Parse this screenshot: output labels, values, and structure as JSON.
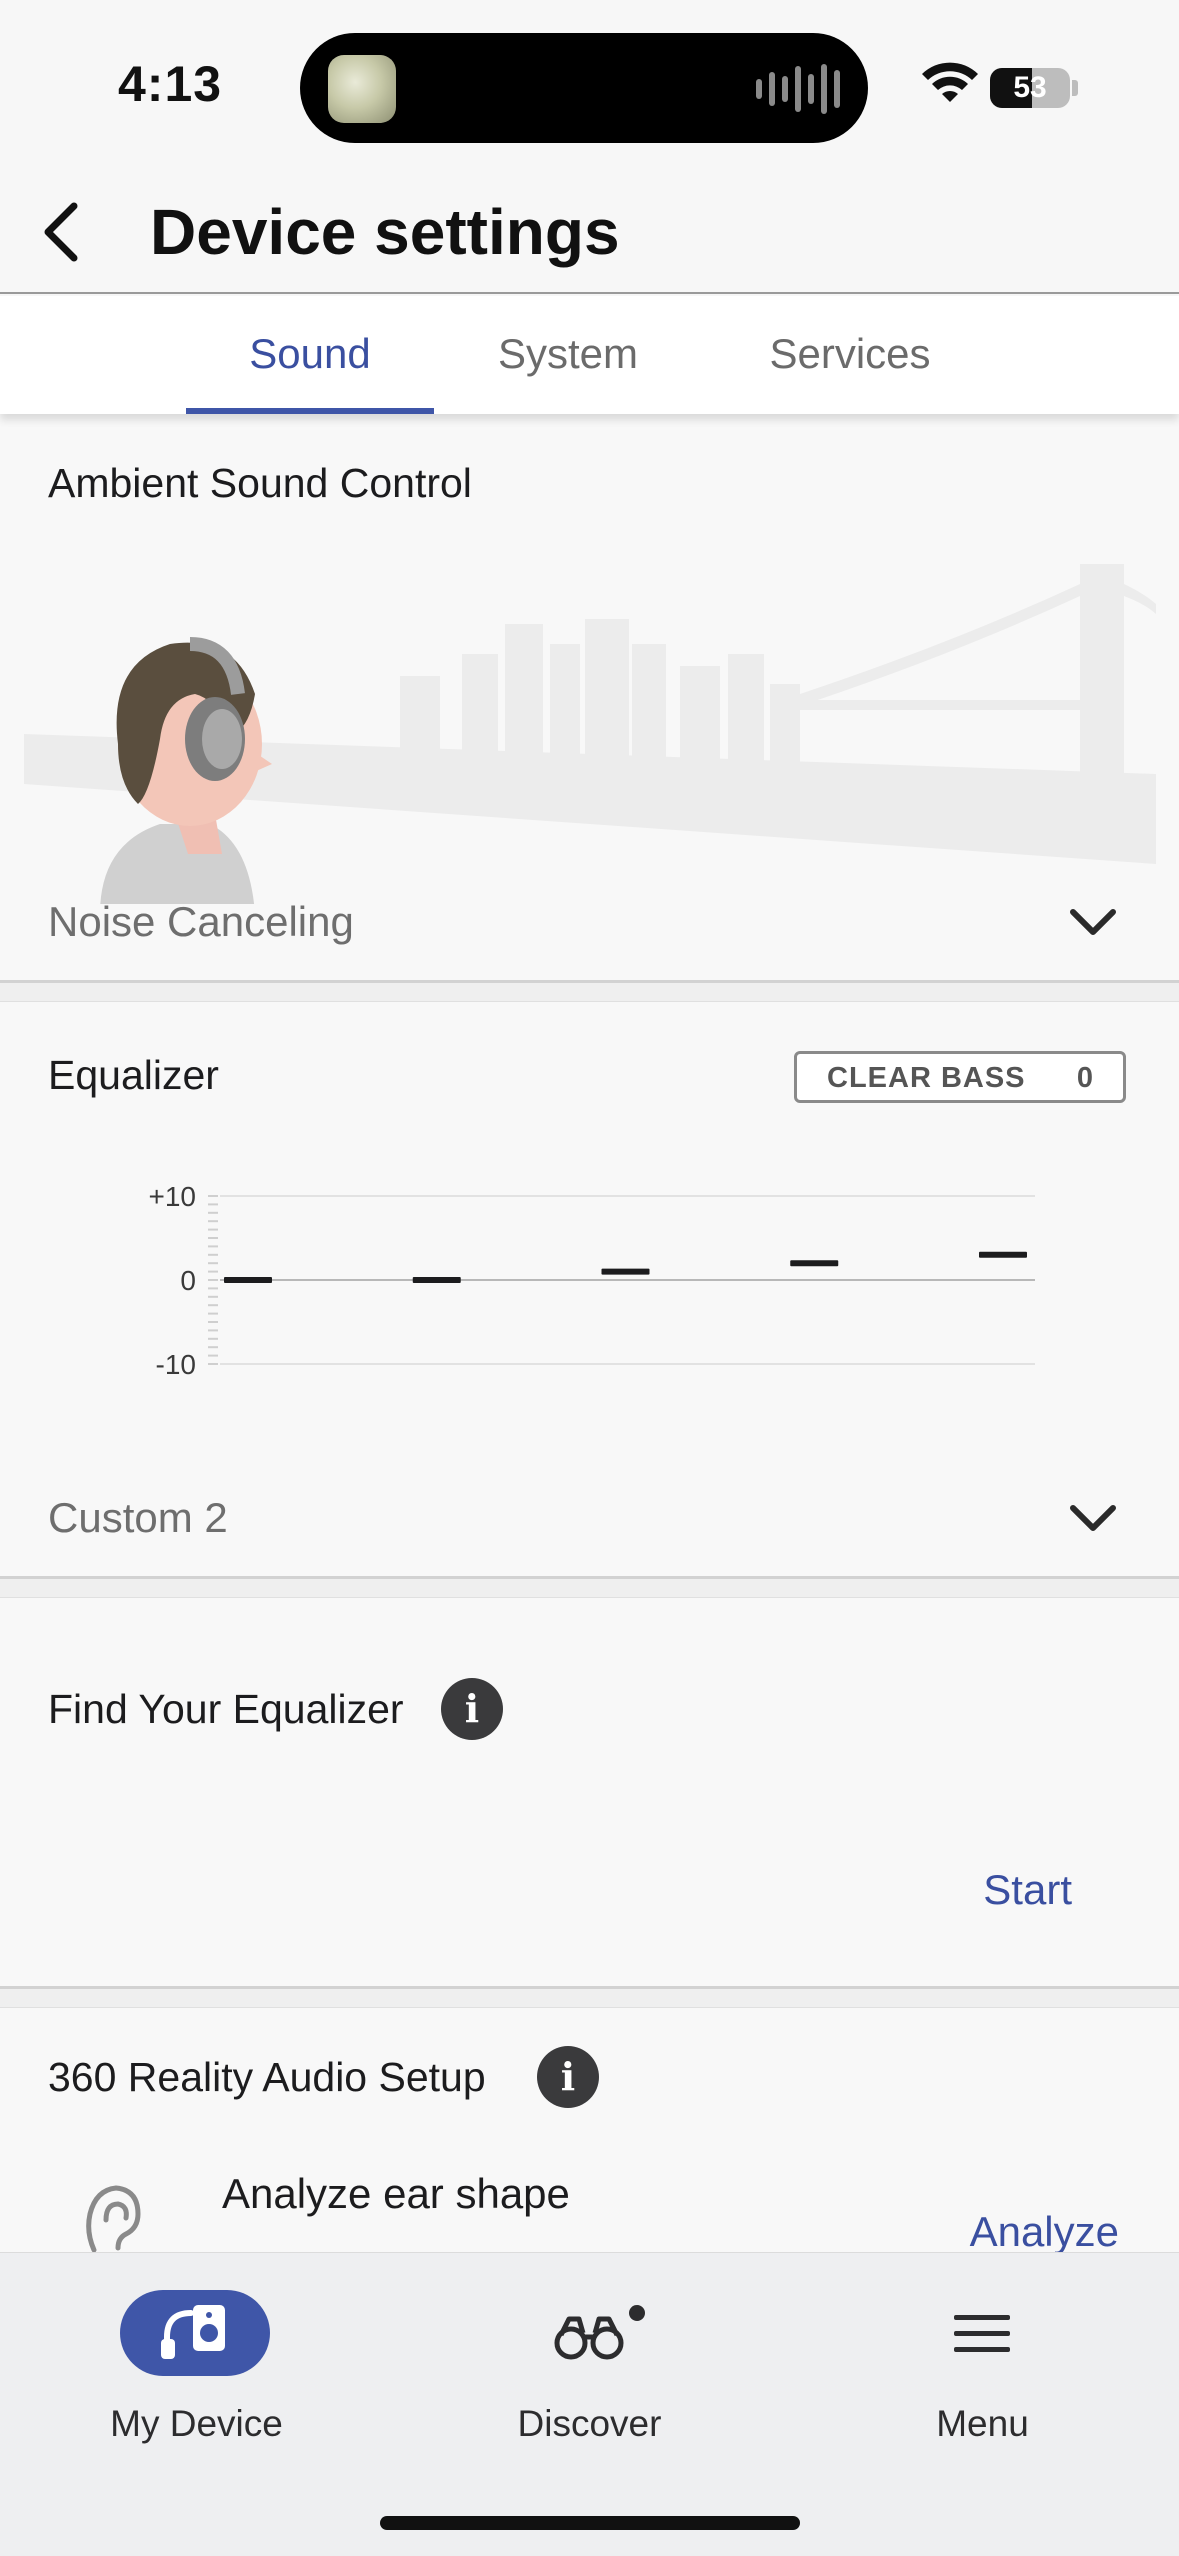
{
  "status_bar": {
    "time": "4:13",
    "battery": "53",
    "battery_level": 0.53
  },
  "header": {
    "title": "Device settings"
  },
  "tabs": [
    {
      "label": "Sound",
      "active": true
    },
    {
      "label": "System",
      "active": false
    },
    {
      "label": "Services",
      "active": false
    }
  ],
  "ambient": {
    "title": "Ambient Sound Control",
    "mode": "Noise Canceling"
  },
  "equalizer": {
    "title": "Equalizer",
    "clear_bass_label": "CLEAR BASS",
    "clear_bass_value": "0",
    "preset": "Custom 2"
  },
  "chart_data": {
    "type": "bar",
    "categories": [
      "1",
      "2",
      "3",
      "4",
      "5"
    ],
    "values": [
      0,
      0,
      1,
      2,
      3
    ],
    "ylim": [
      -10,
      10
    ],
    "yticks": [
      "+10",
      "0",
      "-10"
    ],
    "title": "",
    "xlabel": "",
    "ylabel": ""
  },
  "find_eq": {
    "title": "Find Your Equalizer",
    "action": "Start"
  },
  "reality_audio": {
    "title": "360 Reality Audio Setup",
    "item": "Analyze ear shape",
    "action": "Analyze"
  },
  "bottom_nav": [
    {
      "label": "My Device",
      "icon": "headphones-device-icon",
      "active": true
    },
    {
      "label": "Discover",
      "icon": "binoculars-icon",
      "active": false
    },
    {
      "label": "Menu",
      "icon": "hamburger-menu-icon",
      "active": false
    }
  ],
  "colors": {
    "accent": "#3f56a8",
    "text": "#1c1c1e",
    "muted": "#6e6e6e"
  }
}
